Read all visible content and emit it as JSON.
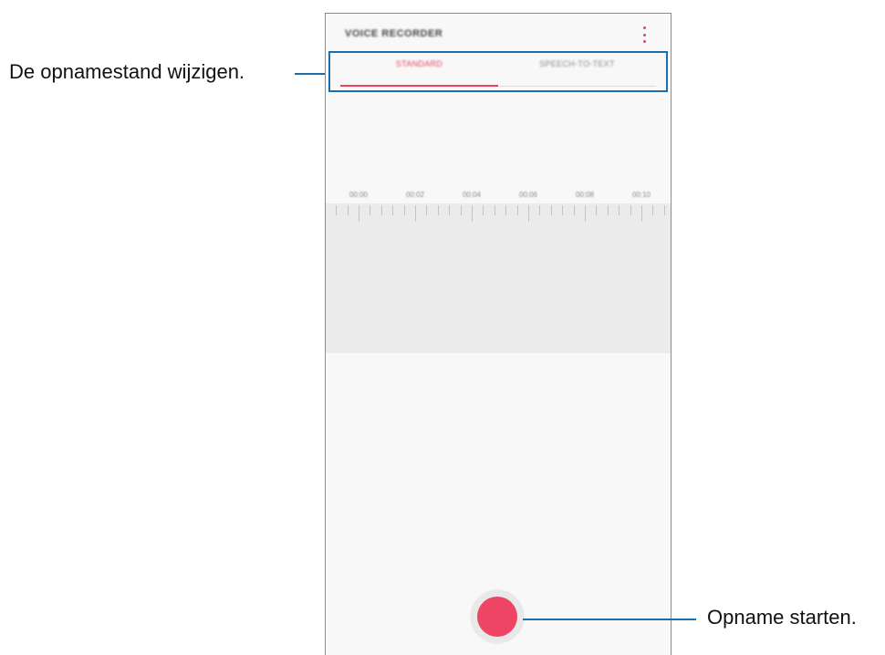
{
  "callouts": {
    "mode": "De opnamestand wijzigen.",
    "record": "Opname starten."
  },
  "app": {
    "title": "VOICE RECORDER",
    "menu_icon": "more-vertical-icon",
    "tabs": [
      {
        "label": "STANDARD",
        "selected": true
      },
      {
        "label": "SPEECH-TO-TEXT",
        "selected": false
      }
    ],
    "timeline": [
      "00:00",
      "00:02",
      "00:04",
      "00:06",
      "00:08",
      "00:10"
    ],
    "record_icon": "record-icon"
  },
  "colors": {
    "accent": "#e8445e",
    "callout_line": "#1a6ead",
    "highlight_box": "#1a6ead",
    "record_button": "#ef4565"
  }
}
